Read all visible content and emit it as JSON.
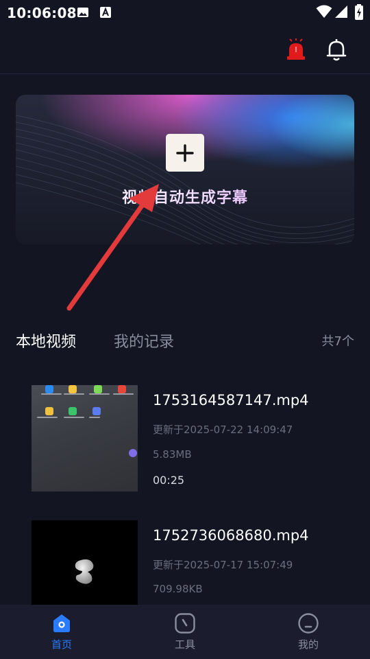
{
  "status_bar": {
    "time": "10:06:08",
    "left_icons": [
      "image-icon",
      "text-a-icon"
    ],
    "right_icons": [
      "wifi-icon",
      "signal-icon",
      "battery-charging-icon"
    ]
  },
  "top_bar": {
    "icons": [
      "alarm-siren-icon",
      "bell-icon"
    ],
    "colors": {
      "alarm": "#e01b1b",
      "bell": "#ffffff"
    }
  },
  "banner": {
    "button_icon": "plus-icon",
    "title": "视频自动生成字幕"
  },
  "tabs": [
    {
      "label": "本地视频",
      "active": true
    },
    {
      "label": "我的记录",
      "active": false
    }
  ],
  "total_count": "共7个",
  "videos": [
    {
      "name": "1753164587147.mp4",
      "updated": "更新于2025-07-22 14:09:47",
      "size": "5.83MB",
      "duration": "00:25"
    },
    {
      "name": "1752736068680.mp4",
      "updated": "更新于2025-07-17 15:07:49",
      "size": "709.98KB",
      "duration": ""
    }
  ],
  "bottom_nav": [
    {
      "label": "首页",
      "icon": "home-icon",
      "active": true
    },
    {
      "label": "工具",
      "icon": "tools-icon",
      "active": false
    },
    {
      "label": "我的",
      "icon": "profile-icon",
      "active": false
    }
  ],
  "colors": {
    "background": "#131523",
    "accent": "#2b7bff",
    "annotation_arrow": "#e33b3b",
    "muted_text": "#8a8d9c"
  }
}
